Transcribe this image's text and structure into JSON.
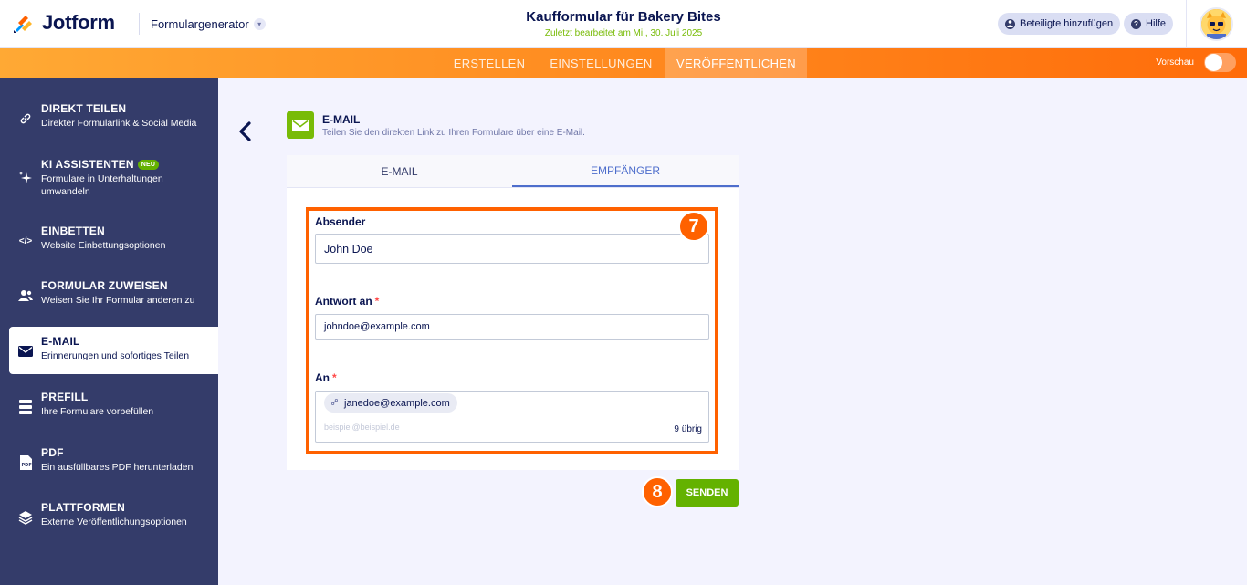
{
  "header": {
    "brand": "Jotform",
    "form_generator": "Formulargenerator",
    "form_title": "Kaufformular für Bakery Bites",
    "last_edited": "Zuletzt bearbeitet am Mi., 30. Juli 2025",
    "add_participants": "Beteiligte hinzufügen",
    "help": "Hilfe"
  },
  "nav": {
    "tabs": [
      {
        "label": "ERSTELLEN"
      },
      {
        "label": "EINSTELLUNGEN"
      },
      {
        "label": "VERÖFFENTLICHEN"
      }
    ],
    "preview_label": "Vorschau"
  },
  "sidebar": {
    "items": [
      {
        "title": "DIREKT TEILEN",
        "subtitle": "Direkter Formularlink & Social Media"
      },
      {
        "title": "KI ASSISTENTEN",
        "badge": "NEU",
        "subtitle": "Formulare in Unterhaltungen umwandeln"
      },
      {
        "title": "EINBETTEN",
        "subtitle": "Website Einbettungsoptionen"
      },
      {
        "title": "FORMULAR ZUWEISEN",
        "subtitle": "Weisen Sie Ihr Formular anderen zu"
      },
      {
        "title": "E-MAIL",
        "subtitle": "Erinnerungen und sofortiges Teilen"
      },
      {
        "title": "PREFILL",
        "subtitle": "Ihre Formulare vorbefüllen"
      },
      {
        "title": "PDF",
        "subtitle": "Ein ausfüllbares PDF herunterladen"
      },
      {
        "title": "PLATTFORMEN",
        "subtitle": "Externe Veröffentlichungsoptionen"
      }
    ]
  },
  "main": {
    "section_title": "E-MAIL",
    "section_subtitle": "Teilen Sie den direkten Link zu Ihren Formulare über eine E-Mail.",
    "tabs": [
      {
        "label": "E-MAIL"
      },
      {
        "label": "EMPFÄNGER"
      }
    ],
    "sender_label": "Absender",
    "sender_value": "John Doe",
    "reply_label": "Antwort an",
    "reply_value": "johndoe@example.com",
    "to_label": "An",
    "to_chip": "janedoe@example.com",
    "to_placeholder": "beispiel@beispiel.de",
    "to_remaining": "9 übrig",
    "required_mark": "*",
    "send_label": "SENDEN",
    "step_badge_1": "7",
    "step_badge_2": "8"
  },
  "colors": {
    "accent_orange": "#ff6100",
    "send_green": "#64b200",
    "sidebar_bg": "#343c6a",
    "active_tab": "#4e6ecc"
  }
}
